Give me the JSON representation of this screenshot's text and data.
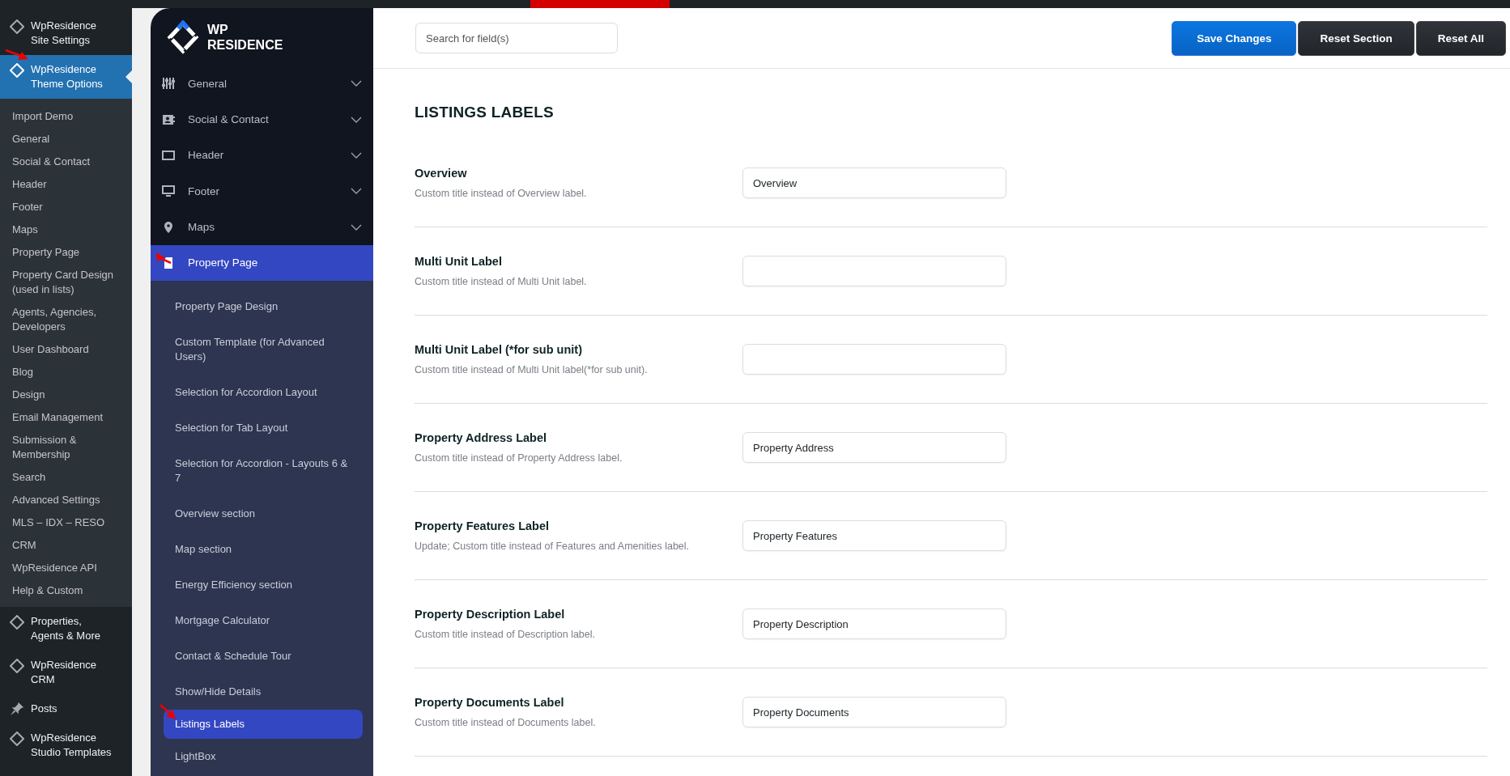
{
  "wp_menu": {
    "items": [
      {
        "label": "WpResidence Site Settings",
        "selected": false
      },
      {
        "label": "WpResidence Theme Options",
        "selected": true,
        "children": [
          {
            "label": "Import Demo"
          },
          {
            "label": "General"
          },
          {
            "label": "Social & Contact"
          },
          {
            "label": "Header"
          },
          {
            "label": "Footer"
          },
          {
            "label": "Maps"
          },
          {
            "label": "Property Page"
          },
          {
            "label": "Property Card Design (used in lists)"
          },
          {
            "label": "Agents, Agencies, Developers"
          },
          {
            "label": "User Dashboard"
          },
          {
            "label": "Blog"
          },
          {
            "label": "Design"
          },
          {
            "label": "Email Management"
          },
          {
            "label": "Submission & Membership"
          },
          {
            "label": "Search"
          },
          {
            "label": "Advanced Settings"
          },
          {
            "label": "MLS – IDX – RESO"
          },
          {
            "label": "CRM"
          },
          {
            "label": "WpResidence API"
          },
          {
            "label": "Help & Custom"
          }
        ]
      },
      {
        "label": "Properties, Agents & More",
        "selected": false
      },
      {
        "label": "WpResidence CRM",
        "selected": false
      },
      {
        "label": "Posts",
        "selected": false,
        "kind": "pin"
      },
      {
        "label": "WpResidence Studio Templates",
        "selected": false
      }
    ]
  },
  "theme_sidebar": {
    "logo": {
      "line_1": "WP",
      "line_2": "RESIDENCE"
    },
    "sections": [
      {
        "label": "General",
        "selected": false,
        "expanded": false
      },
      {
        "label": "Social & Contact",
        "selected": false,
        "expanded": false
      },
      {
        "label": "Header",
        "selected": false,
        "expanded": false
      },
      {
        "label": "Footer",
        "selected": false,
        "expanded": false
      },
      {
        "label": "Maps",
        "selected": false,
        "expanded": false
      },
      {
        "label": "Property Page",
        "selected": true,
        "expanded": true,
        "children": [
          {
            "label": "Property Page Design",
            "selected": false
          },
          {
            "label": "Custom Template (for Advanced Users)",
            "selected": false
          },
          {
            "label": "Selection for Accordion Layout",
            "selected": false
          },
          {
            "label": "Selection for Tab Layout",
            "selected": false
          },
          {
            "label": "Selection for Accordion - Layouts 6 & 7",
            "selected": false
          },
          {
            "label": "Overview section",
            "selected": false
          },
          {
            "label": "Map section",
            "selected": false
          },
          {
            "label": "Energy Efficiency section",
            "selected": false
          },
          {
            "label": "Mortgage Calculator",
            "selected": false
          },
          {
            "label": "Contact & Schedule Tour",
            "selected": false
          },
          {
            "label": "Show/Hide Details",
            "selected": false
          },
          {
            "label": "Listings Labels",
            "selected": true
          },
          {
            "label": "LightBox",
            "selected": false
          }
        ]
      }
    ]
  },
  "toolbar": {
    "search": {
      "placeholder": "Search for field(s)"
    },
    "buttons": [
      {
        "label": "Save Changes",
        "kind": "primary"
      },
      {
        "label": "Reset Section",
        "kind": "dark"
      },
      {
        "label": "Reset All",
        "kind": "dark"
      }
    ]
  },
  "section_title": "LISTINGS LABELS",
  "fields": [
    {
      "label": "Overview",
      "description": "Custom title instead of Overview label.",
      "value": "Overview"
    },
    {
      "label": "Multi Unit Label",
      "description": "Custom title instead of Multi Unit label."
    },
    {
      "label": "Multi Unit Label (*for sub unit)",
      "description": "Custom title instead of Multi Unit label(*for sub unit)."
    },
    {
      "label": "Property Address Label",
      "description": "Custom title instead of Property Address label.",
      "value": "Property Address"
    },
    {
      "label": "Property Features Label",
      "description": "Update; Custom title instead of Features and Amenities label.",
      "value": "Property Features"
    },
    {
      "label": "Property Description Label",
      "description": "Custom title instead of Description label.",
      "value": "Property Description"
    },
    {
      "label": "Property Documents Label",
      "description": "Custom title instead of Documents label.",
      "value": "Property Documents"
    }
  ]
}
